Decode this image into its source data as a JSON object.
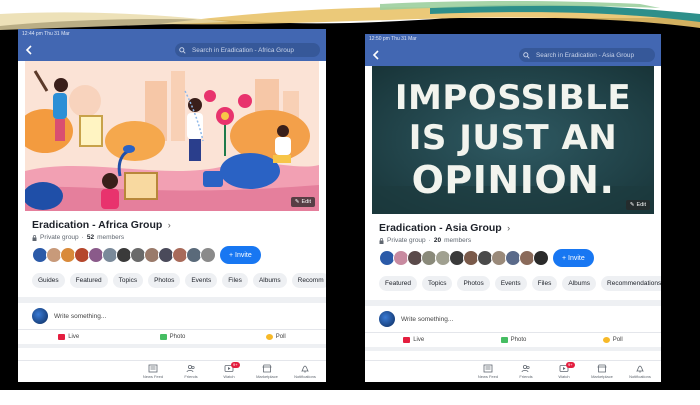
{
  "colors": {
    "facebook_blue": "#4267b2",
    "invite_blue": "#1877f2",
    "live_red": "#e41e3f",
    "photo_green": "#45bd62",
    "poll_orange": "#f7b928"
  },
  "left": {
    "status": "12:44 pm   Thu 31 Mar",
    "search_placeholder": "Search in Eradication - Africa Group",
    "edit_label": "Edit",
    "group_name": "Eradication - Africa Group",
    "privacy": "Private group",
    "member_count": "52",
    "members_label": "members",
    "invite_label": "+ Invite",
    "tabs": [
      "Guides",
      "Featured",
      "Topics",
      "Photos",
      "Events",
      "Files",
      "Albums",
      "Recomm"
    ],
    "composer_placeholder": "Write something...",
    "actions": {
      "live": "Live",
      "photo": "Photo",
      "poll": "Poll"
    },
    "nav": {
      "news_feed": "News Feed",
      "friends": "Friends",
      "watch": "Watch",
      "watch_badge": "9+",
      "marketplace": "Marketplace",
      "notifications": "Notifications"
    }
  },
  "right": {
    "status": "12:50 pm   Thu 31 Mar",
    "search_placeholder": "Search in Eradication - Asia Group",
    "edit_label": "Edit",
    "quote": {
      "line1": "IMPOSSIBLE",
      "line2": "IS JUST AN",
      "line3": "OPINION."
    },
    "group_name": "Eradication - Asia Group",
    "privacy": "Private group",
    "member_count": "20",
    "members_label": "members",
    "invite_label": "+ Invite",
    "tabs": [
      "Featured",
      "Topics",
      "Photos",
      "Events",
      "Files",
      "Albums",
      "Recommendations"
    ],
    "composer_placeholder": "Write something...",
    "actions": {
      "live": "Live",
      "photo": "Photo",
      "poll": "Poll"
    },
    "nav": {
      "news_feed": "News Feed",
      "friends": "Friends",
      "watch": "Watch",
      "watch_badge": "9+",
      "marketplace": "Marketplace",
      "notifications": "Notifications"
    }
  }
}
